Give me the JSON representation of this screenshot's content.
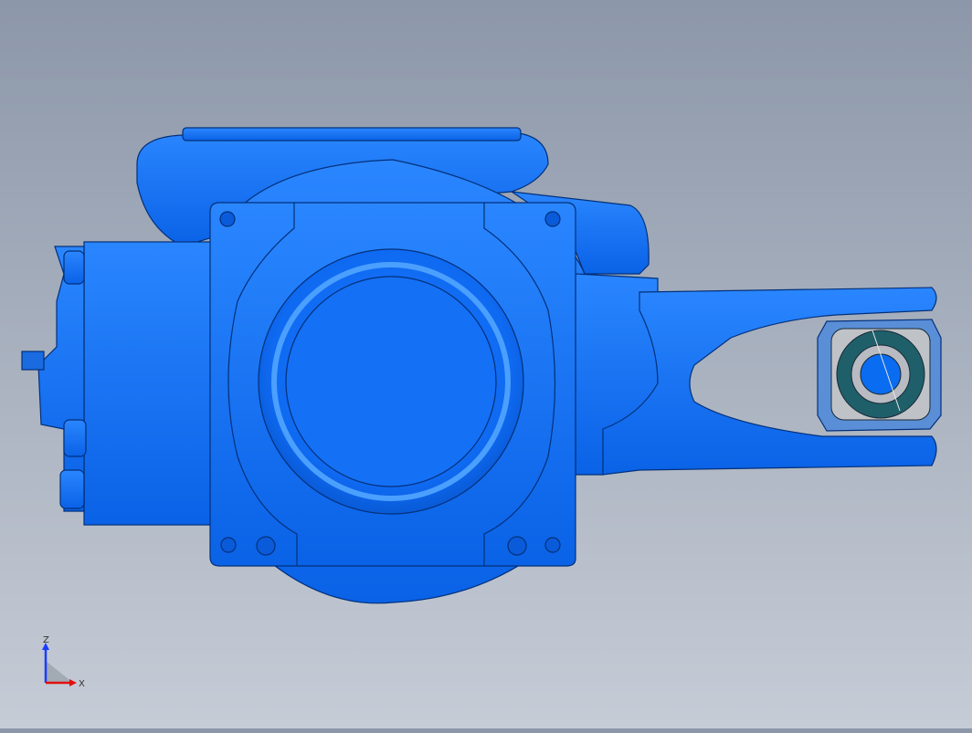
{
  "viewport": {
    "background_top": "#8c97a9",
    "background_bottom": "#c6ccd6",
    "model_color": "#0a6cf0",
    "bearing_color": "#1e5f6a"
  },
  "triad": {
    "z_label": "Z",
    "x_label": "X",
    "z_color": "#1a3cff",
    "x_color": "#e01010"
  }
}
